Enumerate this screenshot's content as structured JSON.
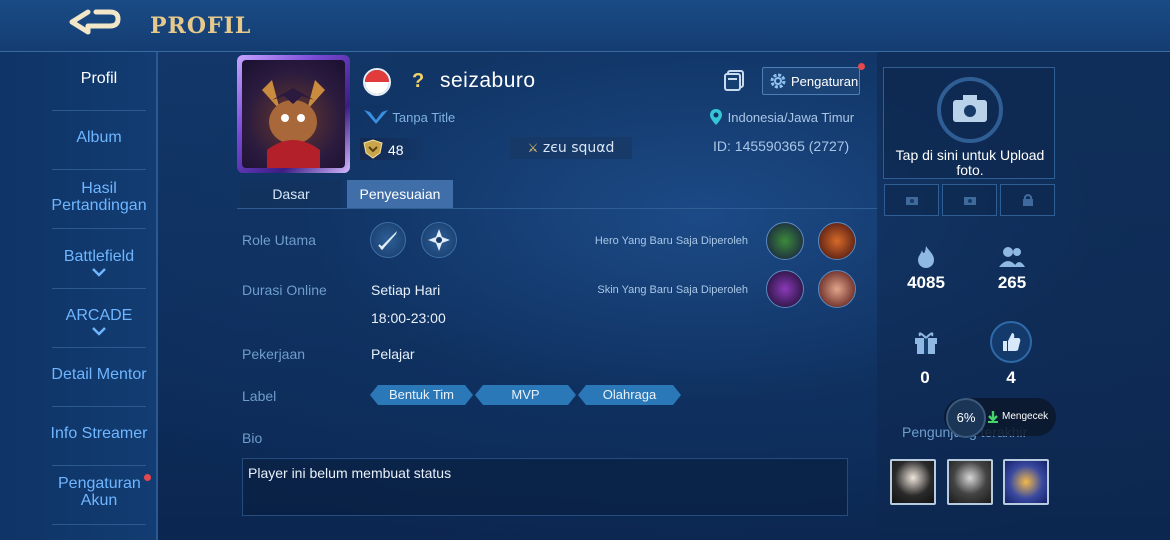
{
  "header": {
    "title": "PROFIL"
  },
  "sidebar": {
    "items": [
      {
        "label": "Profil"
      },
      {
        "label": "Album"
      },
      {
        "label": "Hasil Pertandingan"
      },
      {
        "label": "Battlefield"
      },
      {
        "label": "ARCADE"
      },
      {
        "label": "Detail Mentor"
      },
      {
        "label": "Info Streamer"
      },
      {
        "label": "Pengaturan Akun"
      }
    ]
  },
  "profile": {
    "question_mark": "?",
    "username": "seizaburo",
    "title": "Tanpa Title",
    "level": "48",
    "squad": "ᴢєu squαd",
    "location": "Indonesia/Jawa Timur",
    "id": "ID: 145590365 (2727)",
    "settings_label": "Pengaturan"
  },
  "tabs": [
    {
      "label": "Dasar"
    },
    {
      "label": "Penyesuaian"
    }
  ],
  "details": {
    "role_label": "Role Utama",
    "online_label": "Durasi Online",
    "online_days": "Setiap Hari",
    "online_time": "18:00-23:00",
    "job_label": "Pekerjaan",
    "job_value": "Pelajar",
    "tag_label": "Label",
    "tags": [
      "Bentuk Tim",
      "MVP",
      "Olahraga"
    ],
    "bio_label": "Bio",
    "bio_text": "Player ini belum membuat status",
    "recent_hero_label": "Hero Yang Baru Saja Diperoleh",
    "recent_skin_label": "Skin Yang Baru Saja Diperoleh"
  },
  "right": {
    "upload_text": "Tap di sini untuk Upload foto.",
    "stats": {
      "popularity": "4085",
      "friends": "265",
      "gifts": "0",
      "likes": "4"
    },
    "visitors_label": "Pengunjung terakhir",
    "overlay": {
      "percent": "6%",
      "status": "Mengecek"
    }
  },
  "colors": {
    "accent": "#e7c98b",
    "tag": "#2a78b8",
    "link": "#6fb6ff"
  }
}
